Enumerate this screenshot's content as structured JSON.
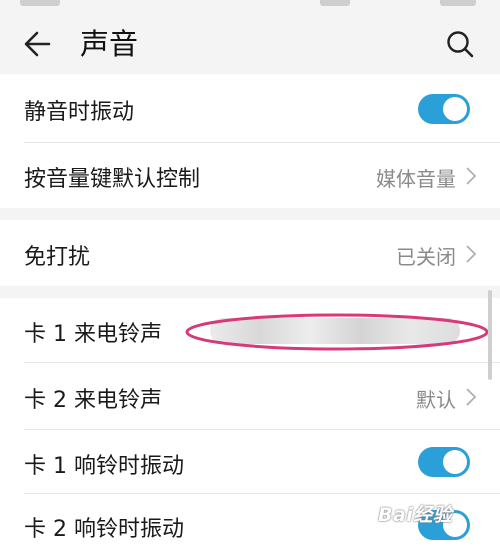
{
  "header": {
    "title": "声音"
  },
  "rows": {
    "silent_vibrate": {
      "label": "静音时振动",
      "toggle": true
    },
    "volume_key": {
      "label": "按音量键默认控制",
      "value": "媒体音量"
    },
    "dnd": {
      "label": "免打扰",
      "value": "已关闭"
    },
    "sim1_ringtone": {
      "label": "卡 1 来电铃声"
    },
    "sim2_ringtone": {
      "label": "卡 2 来电铃声",
      "value": "默认"
    },
    "sim1_vibrate": {
      "label": "卡 1 响铃时振动",
      "toggle": true
    },
    "sim2_vibrate": {
      "label": "卡 2 响铃时振动",
      "toggle": true
    }
  },
  "watermark": {
    "text": "Bai经验"
  },
  "colors": {
    "accent": "#2a9fd8",
    "annotation": "#d63a7a",
    "background": "#f4f4f4"
  },
  "icons": {
    "back": "arrow-left-icon",
    "search": "search-icon",
    "chevron": "chevron-right-icon"
  }
}
